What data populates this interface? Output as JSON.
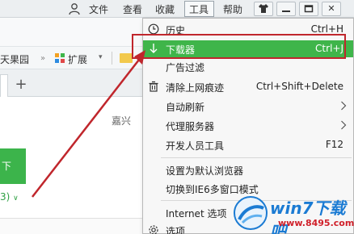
{
  "menubar": {
    "items": [
      "文件",
      "查看",
      "收藏",
      "工具",
      "帮助"
    ],
    "window_controls": {
      "pin": "",
      "minimize": "",
      "restore": "",
      "close": "✕"
    }
  },
  "bookmarks": {
    "site": "天果园",
    "extensions": "扩展"
  },
  "tabs": {
    "new_tab": "+"
  },
  "page": {
    "city": "嘉兴",
    "green_button": "下",
    "green_link": "3)"
  },
  "tools_menu": {
    "items": [
      {
        "label": "历史",
        "shortcut": "Ctrl+H",
        "icon": "clock-icon"
      },
      {
        "label": "下载器",
        "shortcut": "Ctrl+J",
        "icon": "download-arrow-icon",
        "highlighted": true
      },
      {
        "label": "广告过滤",
        "shortcut": ""
      },
      {
        "label": "清除上网痕迹",
        "shortcut": "Ctrl+Shift+Delete",
        "icon": "trash-icon"
      },
      {
        "label": "自动刷新",
        "submenu": true
      },
      {
        "label": "代理服务器",
        "submenu": true
      },
      {
        "label": "开发人员工具",
        "shortcut": "F12"
      },
      {
        "label": "设置为默认浏览器",
        "shortcut": ""
      },
      {
        "label": "切换到IE6多窗口模式",
        "shortcut": ""
      },
      {
        "label": "Internet 选项",
        "shortcut": ""
      },
      {
        "label": "选项",
        "shortcut": "",
        "icon": "gear-icon"
      }
    ]
  },
  "watermark": {
    "title": "win7下载吧",
    "url": "www.8495.com"
  },
  "colors": {
    "highlight_green": "#3fb54a",
    "annotation_red": "#c0262c",
    "watermark_blue": "#1b7bd3"
  }
}
